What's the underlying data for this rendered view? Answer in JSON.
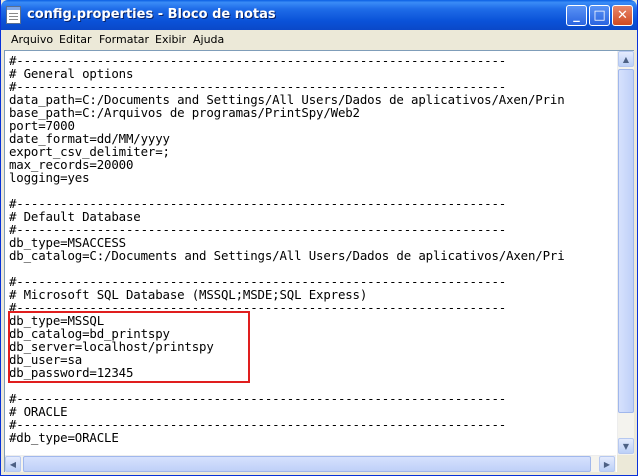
{
  "window": {
    "title": "config.properties - Bloco de notas",
    "minimize_glyph": "_",
    "maximize_glyph": "□",
    "close_glyph": "✕"
  },
  "menu": {
    "items": [
      {
        "label": "Arquivo"
      },
      {
        "label": "Editar"
      },
      {
        "label": "Formatar"
      },
      {
        "label": "Exibir"
      },
      {
        "label": "Ajuda"
      }
    ]
  },
  "editor": {
    "lines": [
      "#-------------------------------------------------------------------",
      "# General options",
      "#-------------------------------------------------------------------",
      "data_path=C:/Documents and Settings/All Users/Dados de aplicativos/Axen/Prin",
      "base_path=C:/Arquivos de programas/PrintSpy/Web2",
      "port=7000",
      "date_format=dd/MM/yyyy",
      "export_csv_delimiter=;",
      "max_records=20000",
      "logging=yes",
      "",
      "#-------------------------------------------------------------------",
      "# Default Database",
      "#-------------------------------------------------------------------",
      "db_type=MSACCESS",
      "db_catalog=C:/Documents and Settings/All Users/Dados de aplicativos/Axen/Pri",
      "",
      "#-------------------------------------------------------------------",
      "# Microsoft SQL Database (MSSQL;MSDE;SQL Express)",
      "#-------------------------------------------------------------------",
      "db_type=MSSQL",
      "db_catalog=bd_printspy",
      "db_server=localhost/printspy",
      "db_user=sa",
      "db_password=12345",
      "",
      "#-------------------------------------------------------------------",
      "# ORACLE",
      "#-------------------------------------------------------------------",
      "#db_type=ORACLE"
    ]
  },
  "scrollbars": {
    "up_arrow": "▲",
    "down_arrow": "▼",
    "left_arrow": "◀",
    "right_arrow": "▶"
  },
  "colors": {
    "titlebar": "#0a52d8",
    "highlight_box": "#e01e1e",
    "close_button": "#cf4a22"
  }
}
